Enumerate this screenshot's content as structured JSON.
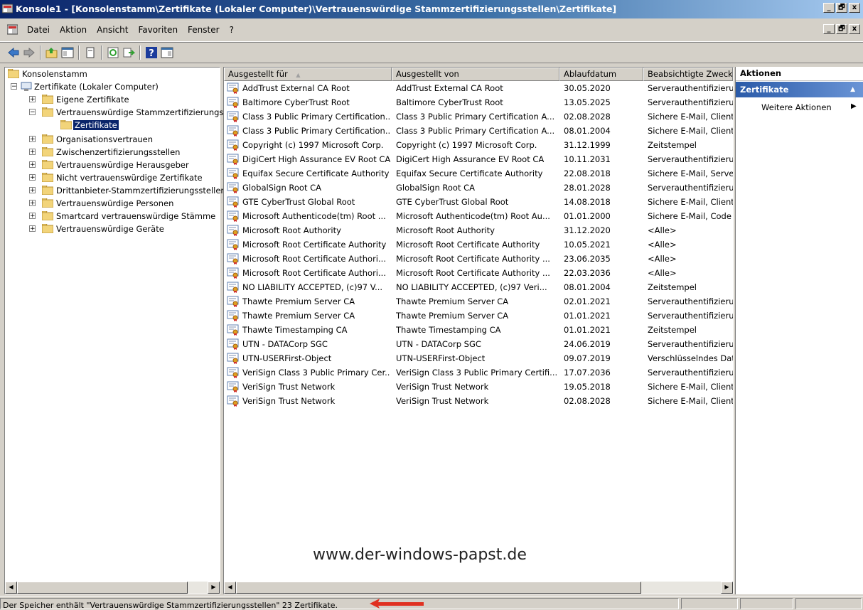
{
  "window": {
    "title": "Konsole1 - [Konsolenstamm\\Zertifikate (Lokaler Computer)\\Vertrauenswürdige Stammzertifizierungsstellen\\Zertifikate]",
    "buttons": {
      "minimize": "_",
      "maximize": "🗗",
      "close": "x"
    }
  },
  "menu": [
    "Datei",
    "Aktion",
    "Ansicht",
    "Favoriten",
    "Fenster",
    "?"
  ],
  "tree": {
    "root": "Konsolenstamm",
    "store": "Zertifikate (Lokaler Computer)",
    "items": [
      {
        "label": "Eigene Zertifikate",
        "expander": "+"
      },
      {
        "label": "Vertrauenswürdige Stammzertifizierungsstellen",
        "expander": "−"
      },
      {
        "label": "Organisationsvertrauen",
        "expander": "+"
      },
      {
        "label": "Zwischenzertifizierungsstellen",
        "expander": "+"
      },
      {
        "label": "Vertrauenswürdige Herausgeber",
        "expander": "+"
      },
      {
        "label": "Nicht vertrauenswürdige Zertifikate",
        "expander": "+"
      },
      {
        "label": "Drittanbieter-Stammzertifizierungsstellen",
        "expander": "+"
      },
      {
        "label": "Vertrauenswürdige Personen",
        "expander": "+"
      },
      {
        "label": "Smartcard vertrauenswürdige Stämme",
        "expander": "+"
      },
      {
        "label": "Vertrauenswürdige Geräte",
        "expander": "+"
      }
    ],
    "selected": "Zertifikate",
    "store_expander": "−"
  },
  "columns": [
    "Ausgestellt für",
    "Ausgestellt von",
    "Ablaufdatum",
    "Beabsichtigte Zweck"
  ],
  "sort_indicator": "▲",
  "rows": [
    [
      "AddTrust External CA Root",
      "AddTrust External CA Root",
      "30.05.2020",
      "Serverauthentifizierung"
    ],
    [
      "Baltimore CyberTrust Root",
      "Baltimore CyberTrust Root",
      "13.05.2025",
      "Serverauthentifizierung"
    ],
    [
      "Class 3 Public Primary Certification...",
      "Class 3 Public Primary Certification A...",
      "02.08.2028",
      "Sichere E-Mail, Client"
    ],
    [
      "Class 3 Public Primary Certification...",
      "Class 3 Public Primary Certification A...",
      "08.01.2004",
      "Sichere E-Mail, Client"
    ],
    [
      "Copyright (c) 1997 Microsoft Corp.",
      "Copyright (c) 1997 Microsoft Corp.",
      "31.12.1999",
      "Zeitstempel"
    ],
    [
      "DigiCert High Assurance EV Root CA",
      "DigiCert High Assurance EV Root CA",
      "10.11.2031",
      "Serverauthentifizierung"
    ],
    [
      "Equifax Secure Certificate Authority",
      "Equifax Secure Certificate Authority",
      "22.08.2018",
      "Sichere E-Mail, Server"
    ],
    [
      "GlobalSign Root CA",
      "GlobalSign Root CA",
      "28.01.2028",
      "Serverauthentifizierung"
    ],
    [
      "GTE CyberTrust Global Root",
      "GTE CyberTrust Global Root",
      "14.08.2018",
      "Sichere E-Mail, Client"
    ],
    [
      "Microsoft Authenticode(tm) Root ...",
      "Microsoft Authenticode(tm) Root Au...",
      "01.01.2000",
      "Sichere E-Mail, Code"
    ],
    [
      "Microsoft Root Authority",
      "Microsoft Root Authority",
      "31.12.2020",
      "<Alle>"
    ],
    [
      "Microsoft Root Certificate Authority",
      "Microsoft Root Certificate Authority",
      "10.05.2021",
      "<Alle>"
    ],
    [
      "Microsoft Root Certificate Authori...",
      "Microsoft Root Certificate Authority ...",
      "23.06.2035",
      "<Alle>"
    ],
    [
      "Microsoft Root Certificate Authori...",
      "Microsoft Root Certificate Authority ...",
      "22.03.2036",
      "<Alle>"
    ],
    [
      "NO LIABILITY ACCEPTED, (c)97 V...",
      "NO LIABILITY ACCEPTED, (c)97 Veri...",
      "08.01.2004",
      "Zeitstempel"
    ],
    [
      "Thawte Premium Server CA",
      "Thawte Premium Server CA",
      "02.01.2021",
      "Serverauthentifizierung"
    ],
    [
      "Thawte Premium Server CA",
      "Thawte Premium Server CA",
      "01.01.2021",
      "Serverauthentifizierung"
    ],
    [
      "Thawte Timestamping CA",
      "Thawte Timestamping CA",
      "01.01.2021",
      "Zeitstempel"
    ],
    [
      "UTN - DATACorp SGC",
      "UTN - DATACorp SGC",
      "24.06.2019",
      "Serverauthentifizierung"
    ],
    [
      "UTN-USERFirst-Object",
      "UTN-USERFirst-Object",
      "09.07.2019",
      "Verschlüsselndes Dateisystem"
    ],
    [
      "VeriSign Class 3 Public Primary Cer...",
      "VeriSign Class 3 Public Primary Certifi...",
      "17.07.2036",
      "Serverauthentifizierung"
    ],
    [
      "VeriSign Trust Network",
      "VeriSign Trust Network",
      "19.05.2018",
      "Sichere E-Mail, Client"
    ],
    [
      "VeriSign Trust Network",
      "VeriSign Trust Network",
      "02.08.2028",
      "Sichere E-Mail, Client"
    ]
  ],
  "actions": {
    "title": "Aktionen",
    "section": "Zertifikate",
    "section_arrow": "▲",
    "more": "Weitere Aktionen",
    "more_arrow": "▶"
  },
  "watermark": "www.der-windows-papst.de",
  "status": "Der Speicher enthält \"Vertrauenswürdige Stammzertifizierungsstellen\" 23 Zertifikate.",
  "scroll_arrows": {
    "left": "◀",
    "right": "▶"
  },
  "colors": {
    "title_bar": "#0a246a",
    "selection": "#0a246a",
    "action_header": "#2a5aa8",
    "status_arrow": "#e03020"
  },
  "icons": {
    "app": "mmc-console-icon",
    "back": "back-arrow-icon",
    "forward": "forward-arrow-icon",
    "up": "up-folder-icon",
    "tree_toggle": "show-hide-tree-icon",
    "properties": "properties-icon",
    "refresh": "refresh-icon",
    "export": "export-list-icon",
    "help": "help-icon",
    "action_pane": "action-pane-icon",
    "folder": "folder-icon",
    "certificate": "certificate-icon"
  }
}
